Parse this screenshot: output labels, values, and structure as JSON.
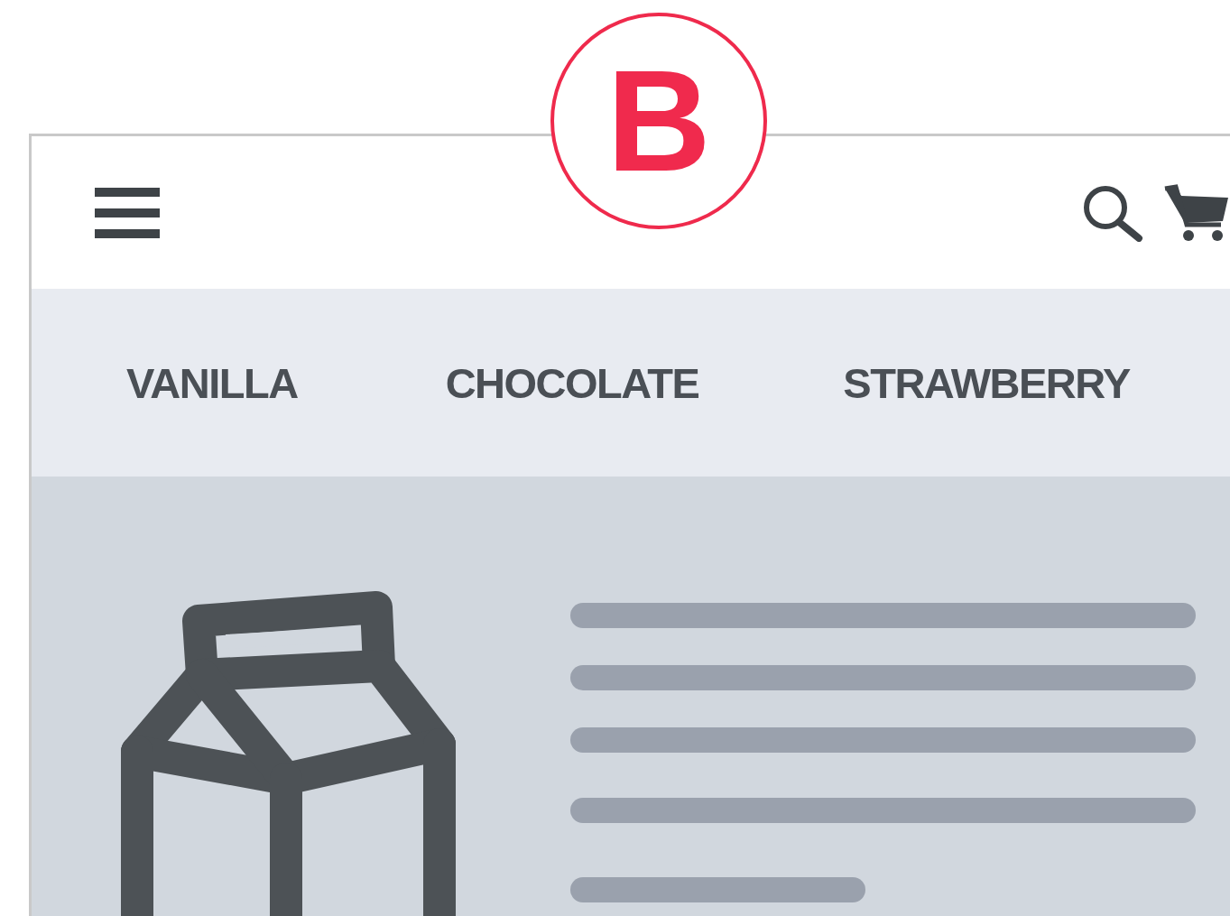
{
  "badge": {
    "label": "B"
  },
  "tabs": [
    {
      "label": "VANILLA"
    },
    {
      "label": "CHOCOLATE"
    },
    {
      "label": "STRAWBERRY"
    }
  ],
  "content": {
    "text_lines": [
      {
        "kind": "full"
      },
      {
        "kind": "full"
      },
      {
        "kind": "full"
      },
      {
        "kind": "full"
      },
      {
        "kind": "short"
      }
    ]
  }
}
